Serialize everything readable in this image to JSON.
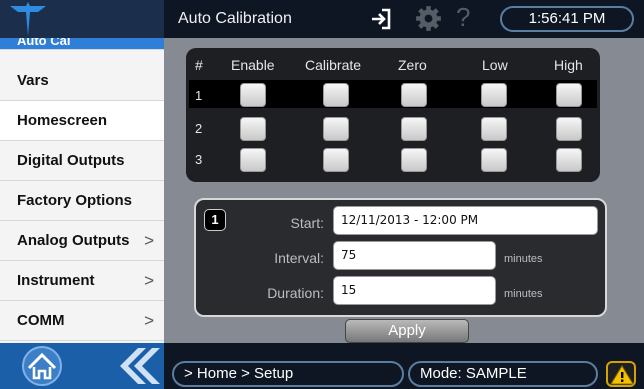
{
  "header": {
    "title": "Auto Calibration",
    "time": "1:56:41 PM"
  },
  "sidebar": {
    "items": [
      {
        "label": "Auto Cal",
        "chevron": ""
      },
      {
        "label": "Vars",
        "chevron": ""
      },
      {
        "label": "Homescreen",
        "chevron": ""
      },
      {
        "label": "Digital Outputs",
        "chevron": ""
      },
      {
        "label": "Factory Options",
        "chevron": ""
      },
      {
        "label": "Analog Outputs",
        "chevron": ">"
      },
      {
        "label": "Instrument",
        "chevron": ">"
      },
      {
        "label": "COMM",
        "chevron": ">"
      }
    ]
  },
  "grid": {
    "columns": [
      "#",
      "Enable",
      "Calibrate",
      "Zero",
      "Low",
      "High"
    ],
    "rows": [
      "1",
      "2",
      "3"
    ]
  },
  "detail": {
    "sequence": "1",
    "start_label": "Start:",
    "start_value": "12/11/2013 - 12:00 PM",
    "interval_label": "Interval:",
    "interval_value": "75",
    "interval_unit": "minutes",
    "duration_label": "Duration:",
    "duration_value": "15",
    "duration_unit": "minutes"
  },
  "apply_label": "Apply",
  "status": {
    "breadcrumb": "> Home > Setup",
    "mode": "Mode: SAMPLE"
  },
  "icons": {
    "logo": "teledyne-logo-icon",
    "exit": "exit-icon",
    "gear": "gear-icon",
    "help": "help-icon",
    "home": "home-icon",
    "back": "double-chevron-left-icon",
    "warning": "warning-icon"
  },
  "colors": {
    "accent": "#2f7fd8",
    "header_bg": "#0e1624",
    "nav_bg": "#1b5fa8",
    "warning": "#f2c100"
  }
}
